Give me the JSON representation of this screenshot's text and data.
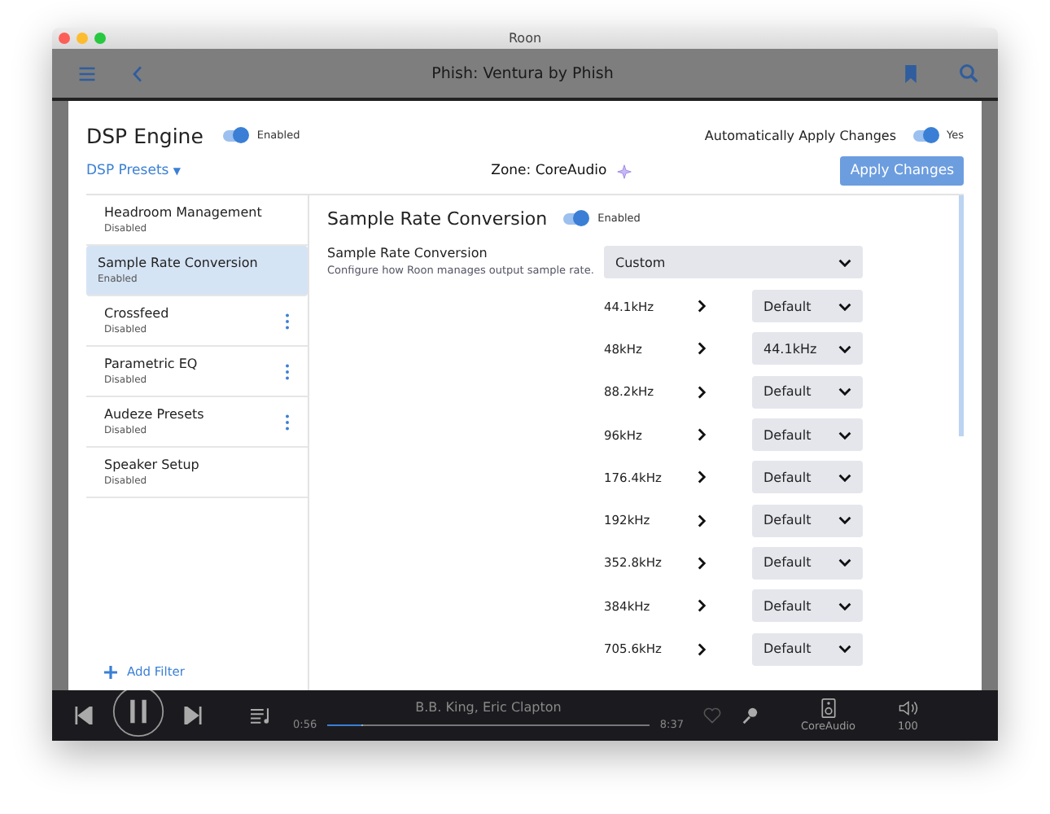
{
  "window": {
    "title": "Roon"
  },
  "toolbar": {
    "title": "Phish: Ventura by Phish"
  },
  "dsp_engine": {
    "title": "DSP Engine",
    "on": true,
    "state_label": "Enabled"
  },
  "auto_apply": {
    "label": "Automatically Apply Changes",
    "on": true,
    "state_label": "Yes"
  },
  "presets": {
    "label": "DSP Presets",
    "caret": "▼"
  },
  "zone": {
    "label": "Zone: CoreAudio"
  },
  "apply_button": {
    "label": "Apply Changes",
    "disabled": true
  },
  "filters": [
    {
      "name": "Headroom Management",
      "status": "Disabled",
      "selected": false,
      "has_menu": false
    },
    {
      "name": "Sample Rate Conversion",
      "status": "Enabled",
      "selected": true,
      "has_menu": false
    },
    {
      "name": "Crossfeed",
      "status": "Disabled",
      "selected": false,
      "has_menu": true
    },
    {
      "name": "Parametric EQ",
      "status": "Disabled",
      "selected": false,
      "has_menu": true
    },
    {
      "name": "Audeze Presets",
      "status": "Disabled",
      "selected": false,
      "has_menu": true
    },
    {
      "name": "Speaker Setup",
      "status": "Disabled",
      "selected": false,
      "has_menu": false
    }
  ],
  "add_filter": {
    "label": "Add Filter"
  },
  "panel": {
    "title": "Sample Rate Conversion",
    "on": true,
    "state_label": "Enabled",
    "setting": {
      "label": "Sample Rate Conversion",
      "description": "Configure how Roon manages output sample rate.",
      "value": "Custom"
    },
    "rates": [
      {
        "rate": "44.1kHz",
        "value": "Default"
      },
      {
        "rate": "48kHz",
        "value": "44.1kHz"
      },
      {
        "rate": "88.2kHz",
        "value": "Default"
      },
      {
        "rate": "96kHz",
        "value": "Default"
      },
      {
        "rate": "176.4kHz",
        "value": "Default"
      },
      {
        "rate": "192kHz",
        "value": "Default"
      },
      {
        "rate": "352.8kHz",
        "value": "Default"
      },
      {
        "rate": "384kHz",
        "value": "Default"
      },
      {
        "rate": "705.6kHz",
        "value": "Default"
      }
    ]
  },
  "player": {
    "track": "B.B. King, Eric Clapton",
    "elapsed": "0:56",
    "total": "8:37",
    "level": 0.11,
    "zone": "CoreAudio",
    "volume": "100"
  }
}
